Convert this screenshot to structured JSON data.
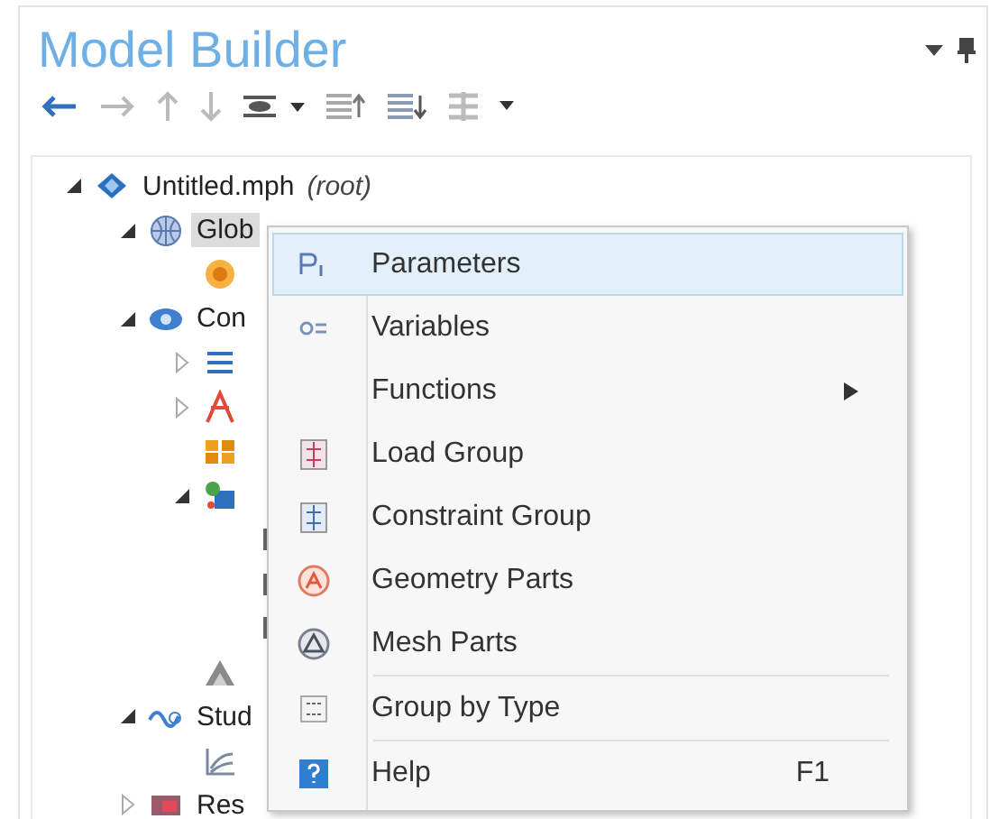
{
  "panel": {
    "title": "Model Builder"
  },
  "tree": [
    {
      "label": "Untitled.mph",
      "note": "(root)",
      "kind": "file",
      "expanded": true,
      "selected": false,
      "children": [
        {
          "label": "Glob",
          "kind": "globe",
          "expanded": true,
          "selected": true,
          "children": [
            {
              "kind": "parameters"
            }
          ]
        },
        {
          "label": "Con",
          "kind": "component",
          "expanded": true,
          "selected": false,
          "children": [
            {
              "kind": "definitions",
              "expanded": false
            },
            {
              "kind": "geometry",
              "expanded": false
            },
            {
              "kind": "materials"
            },
            {
              "kind": "physics",
              "expanded": true,
              "children": [
                {
                  "kind": "node"
                },
                {
                  "kind": "node"
                },
                {
                  "kind": "node"
                }
              ]
            },
            {
              "kind": "mesh"
            }
          ]
        },
        {
          "label": "Stud",
          "kind": "study",
          "expanded": true,
          "selected": false,
          "children": [
            {
              "kind": "step"
            }
          ]
        },
        {
          "label": "Res",
          "kind": "results",
          "expanded": false,
          "selected": false
        }
      ]
    }
  ],
  "context_menu": [
    {
      "label": "Parameters",
      "kind": "parameters",
      "selected": true
    },
    {
      "label": "Variables",
      "kind": "variables",
      "selected": false
    },
    {
      "label": "Functions",
      "kind": "none",
      "selected": false,
      "submenu": true
    },
    {
      "label": "Load Group",
      "kind": "load",
      "selected": false
    },
    {
      "label": "Constraint Group",
      "kind": "constraint",
      "selected": false
    },
    {
      "label": "Geometry Parts",
      "kind": "geomparts",
      "selected": false
    },
    {
      "label": "Mesh Parts",
      "kind": "meshparts",
      "selected": false
    },
    {
      "label": "Group by Type",
      "kind": "group",
      "selected": false,
      "separator_before": true
    },
    {
      "label": "Help",
      "kind": "help",
      "selected": false,
      "separator_before": true,
      "shortcut": "F1"
    }
  ]
}
